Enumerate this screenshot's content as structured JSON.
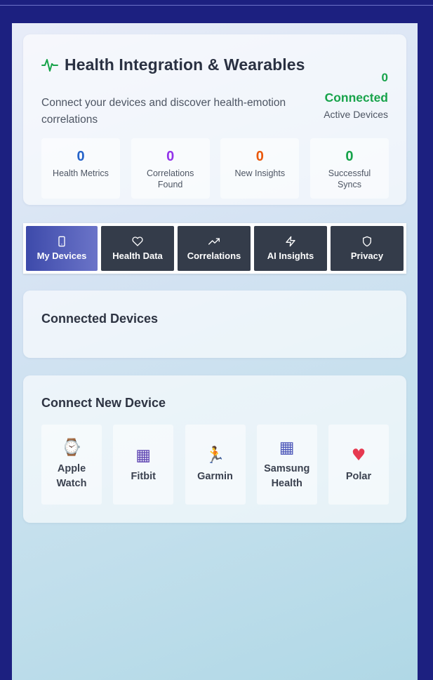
{
  "header": {
    "title": "Health Integration & Wearables",
    "subtitle": "Connect your devices and discover health-emotion correlations",
    "connected_count": "0",
    "connected_label": "Connected",
    "active_devices_label": "Active Devices"
  },
  "stats": [
    {
      "value": "0",
      "label": "Health Metrics",
      "color": "#2563c9"
    },
    {
      "value": "0",
      "label": "Correlations Found",
      "color": "#9333ea"
    },
    {
      "value": "0",
      "label": "New Insights",
      "color": "#ea580c"
    },
    {
      "value": "0",
      "label": "Successful Syncs",
      "color": "#16a34a"
    }
  ],
  "tabs": [
    {
      "label": "My Devices",
      "icon": "phone-icon",
      "active": true
    },
    {
      "label": "Health Data",
      "icon": "heart-icon",
      "active": false
    },
    {
      "label": "Correlations",
      "icon": "trending-up-icon",
      "active": false
    },
    {
      "label": "AI Insights",
      "icon": "lightning-icon",
      "active": false
    },
    {
      "label": "Privacy",
      "icon": "shield-icon",
      "active": false
    }
  ],
  "connected_devices": {
    "title": "Connected Devices"
  },
  "new_device": {
    "title": "Connect New Device",
    "devices": [
      {
        "name": "Apple Watch",
        "icon": "watch-icon",
        "glyph": "⌚"
      },
      {
        "name": "Fitbit",
        "icon": "fitbit-icon",
        "glyph": "▦"
      },
      {
        "name": "Garmin",
        "icon": "runner-icon",
        "glyph": "🏃"
      },
      {
        "name": "Samsung Health",
        "icon": "samsung-health-icon",
        "glyph": "▦"
      },
      {
        "name": "Polar",
        "icon": "heart-icon",
        "glyph": "♥"
      }
    ]
  }
}
